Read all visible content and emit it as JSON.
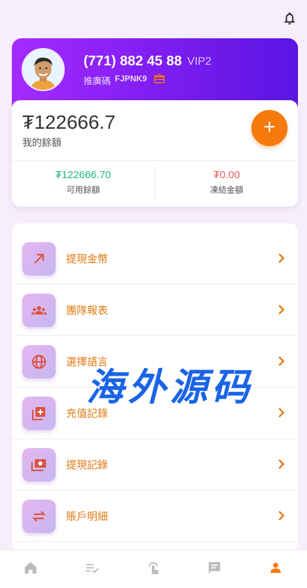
{
  "profile": {
    "phone": "(771) 882 45 88",
    "vip": "VIP2",
    "ref_label": "推廣碼",
    "ref_code": "FJPNK9"
  },
  "balance": {
    "amount": "₮122666.7",
    "label": "我的餘額",
    "available_value": "₮122666.70",
    "available_label": "可用餘額",
    "frozen_value": "₮0.00",
    "frozen_label": "凍結金額"
  },
  "menu": [
    {
      "label": "提現金幣",
      "icon": "arrow-up-right-icon"
    },
    {
      "label": "團隊報表",
      "icon": "team-icon"
    },
    {
      "label": "選擇語言",
      "icon": "globe-icon"
    },
    {
      "label": "充值記錄",
      "icon": "add-box-icon"
    },
    {
      "label": "提現記錄",
      "icon": "cash-icon"
    },
    {
      "label": "賬戶明細",
      "icon": "swap-icon"
    }
  ],
  "watermark": "海外源码",
  "nav": [
    {
      "icon": "home-icon"
    },
    {
      "icon": "task-list-icon"
    },
    {
      "icon": "touch-icon"
    },
    {
      "icon": "message-icon"
    },
    {
      "icon": "person-icon",
      "active": true
    }
  ],
  "colors": {
    "accent": "#f5790c",
    "gradient_start": "#a52bff",
    "gradient_end": "#5a15e2",
    "green": "#1bb77a",
    "red": "#e85b5b"
  }
}
